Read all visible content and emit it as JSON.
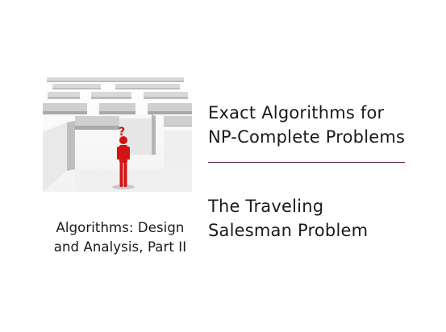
{
  "slide": {
    "title_line1": "Exact Algorithms for",
    "title_line2": "NP-Complete Problems",
    "subtitle_line1": "The Traveling",
    "subtitle_line2": "Salesman Problem",
    "course_line1": "Algorithms: Design",
    "course_line2": "and Analysis, Part II",
    "image_mark": "?"
  },
  "colors": {
    "rule": "#5a2a4a",
    "figure": "#d11414",
    "maze_wall": "#ececec"
  }
}
